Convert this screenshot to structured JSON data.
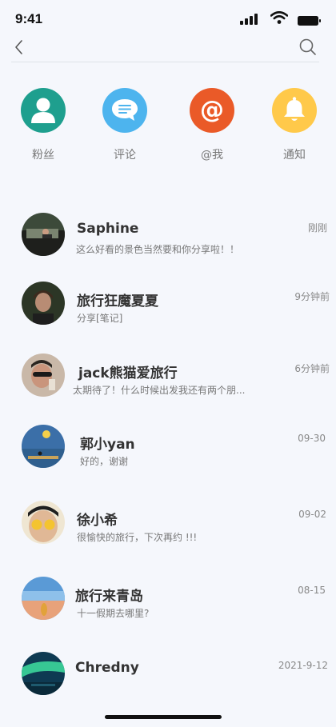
{
  "status_bar": {
    "time": "9:41"
  },
  "quick_actions": [
    {
      "label": "粉丝",
      "icon": "user-icon",
      "color": "#1e9f8e"
    },
    {
      "label": "评论",
      "icon": "comment-icon",
      "color": "#4db4ee"
    },
    {
      "label": "@我",
      "icon": "at-icon",
      "color": "#ea5a28"
    },
    {
      "label": "通知",
      "icon": "bell-icon",
      "color": "#ffc94a"
    }
  ],
  "conversations": [
    {
      "name": "Saphine",
      "preview": "这么好看的景色当然要和你分享啦！！",
      "time": "刚刚"
    },
    {
      "name": "旅行狂魔夏夏",
      "preview": "分享[笔记]",
      "time": "9分钟前"
    },
    {
      "name": "jack熊猫爱旅行",
      "preview": "太期待了！什么时候出发我还有两个朋...",
      "time": "6分钟前"
    },
    {
      "name": "郭小yan",
      "preview": "好的，谢谢",
      "time": "09-30"
    },
    {
      "name": "徐小希",
      "preview": "很愉快的旅行，下次再约 !!!",
      "time": "09-02"
    },
    {
      "name": "旅行来青岛",
      "preview": "十一假期去哪里?",
      "time": "08-15"
    },
    {
      "name": "Chredny",
      "preview": "",
      "time": "2021-9-12"
    }
  ]
}
